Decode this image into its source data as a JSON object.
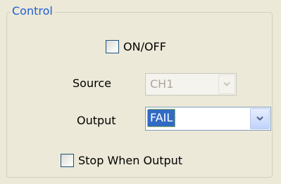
{
  "group": {
    "title": "Control"
  },
  "onoff": {
    "label": "ON/OFF",
    "checked": false
  },
  "source": {
    "label": "Source",
    "value": "CH1",
    "enabled": false
  },
  "output": {
    "label": "Output",
    "value": "FAIL",
    "enabled": true
  },
  "stop_when_output": {
    "label": "Stop When Output",
    "checked": false
  },
  "colors": {
    "group_title": "#1d5fd1",
    "selection": "#316ac5",
    "background": "#ece9d8"
  }
}
